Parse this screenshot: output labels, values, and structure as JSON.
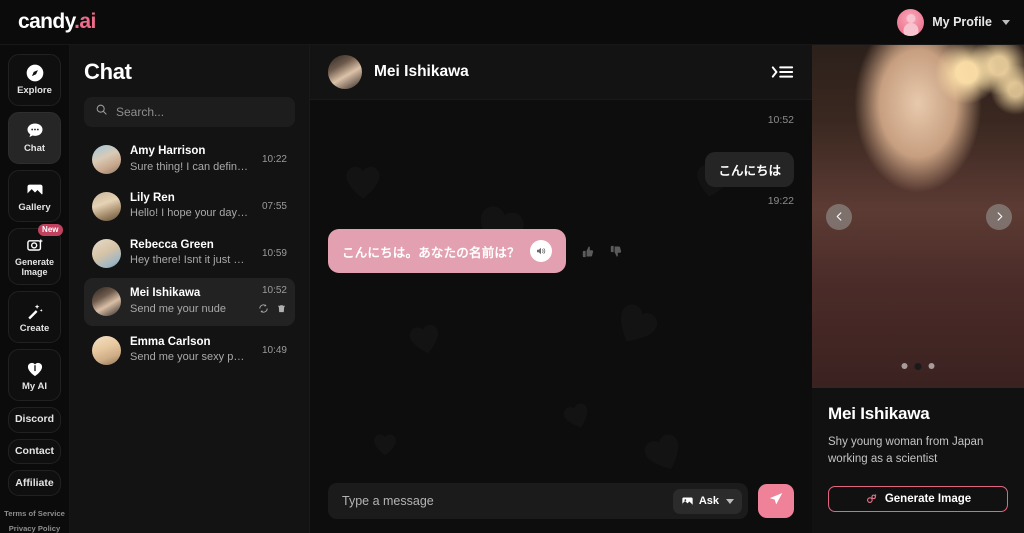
{
  "brand": {
    "name": "candy",
    "suffix": ".ai"
  },
  "topbar": {
    "profile_label": "My Profile",
    "avatar_icon": "user-avatar-icon",
    "chevron_icon": "chevron-down-icon"
  },
  "rail": {
    "items": [
      {
        "label": "Explore",
        "icon": "compass-icon",
        "active": false,
        "badge": null
      },
      {
        "label": "Chat",
        "icon": "chat-bubble-icon",
        "active": true,
        "badge": null
      },
      {
        "label": "Gallery",
        "icon": "image-icon",
        "active": false,
        "badge": null
      },
      {
        "label": "Generate Image",
        "icon": "camera-sparkle-icon",
        "active": false,
        "badge": "New"
      },
      {
        "label": "Create",
        "icon": "magic-wand-icon",
        "active": false,
        "badge": null
      },
      {
        "label": "My AI",
        "icon": "heart-icon",
        "active": false,
        "badge": null
      }
    ],
    "links": [
      {
        "label": "Discord"
      },
      {
        "label": "Contact"
      },
      {
        "label": "Affiliate"
      }
    ],
    "legal": [
      {
        "label": "Terms of Service"
      },
      {
        "label": "Privacy Policy"
      }
    ]
  },
  "chatlist": {
    "title": "Chat",
    "search": {
      "placeholder": "Search...",
      "icon": "search-icon"
    },
    "conversations": [
      {
        "name": "Amy Harrison",
        "preview": "Sure thing! I can definitel...",
        "time": "10:22",
        "active": false
      },
      {
        "name": "Lily Ren",
        "preview": "Hello! I hope your day is g...",
        "time": "07:55",
        "active": false
      },
      {
        "name": "Rebecca Green",
        "preview": "Hey there! Isnt it just a p...",
        "time": "10:59",
        "active": false
      },
      {
        "name": "Mei Ishikawa",
        "preview": "Send me your nude",
        "time": "10:52",
        "active": true
      },
      {
        "name": "Emma Carlson",
        "preview": "Send me your sexy photo",
        "time": "10:49",
        "active": false
      }
    ],
    "row_actions": {
      "refresh_icon": "refresh-icon",
      "delete_icon": "trash-icon"
    }
  },
  "conversation": {
    "header": {
      "name": "Mei Ishikawa",
      "collapse_icon": "collapse-panel-icon"
    },
    "messages": [
      {
        "type": "timestamp",
        "text": "10:52"
      },
      {
        "type": "outgoing",
        "text": "こんにちは"
      },
      {
        "type": "timestamp",
        "text": "19:22"
      },
      {
        "type": "incoming",
        "text": "こんにちは。あなたの名前は？",
        "speaker_icon": "speaker-icon",
        "like_icon": "thumbs-up-icon",
        "dislike_icon": "thumbs-down-icon"
      }
    ],
    "composer": {
      "placeholder": "Type a message",
      "ask_label": "Ask",
      "ask_icon": "image-icon",
      "ask_chevron_icon": "chevron-down-icon",
      "send_icon": "send-icon"
    }
  },
  "rpanel": {
    "carousel": {
      "prev_icon": "chevron-left-icon",
      "next_icon": "chevron-right-icon",
      "dots": 3,
      "active_dot": 1
    },
    "name": "Mei Ishikawa",
    "description": "Shy young woman from Japan working as a scientist",
    "generate_button": {
      "label": "Generate Image",
      "icon": "generate-image-icon"
    }
  },
  "colors": {
    "accent_pink": "#ef6b8a",
    "incoming_bubble": "#e3a0b0",
    "outgoing_bubble": "#252525",
    "badge_new": "#c2415f",
    "app_bg": "#0a0a0a"
  }
}
